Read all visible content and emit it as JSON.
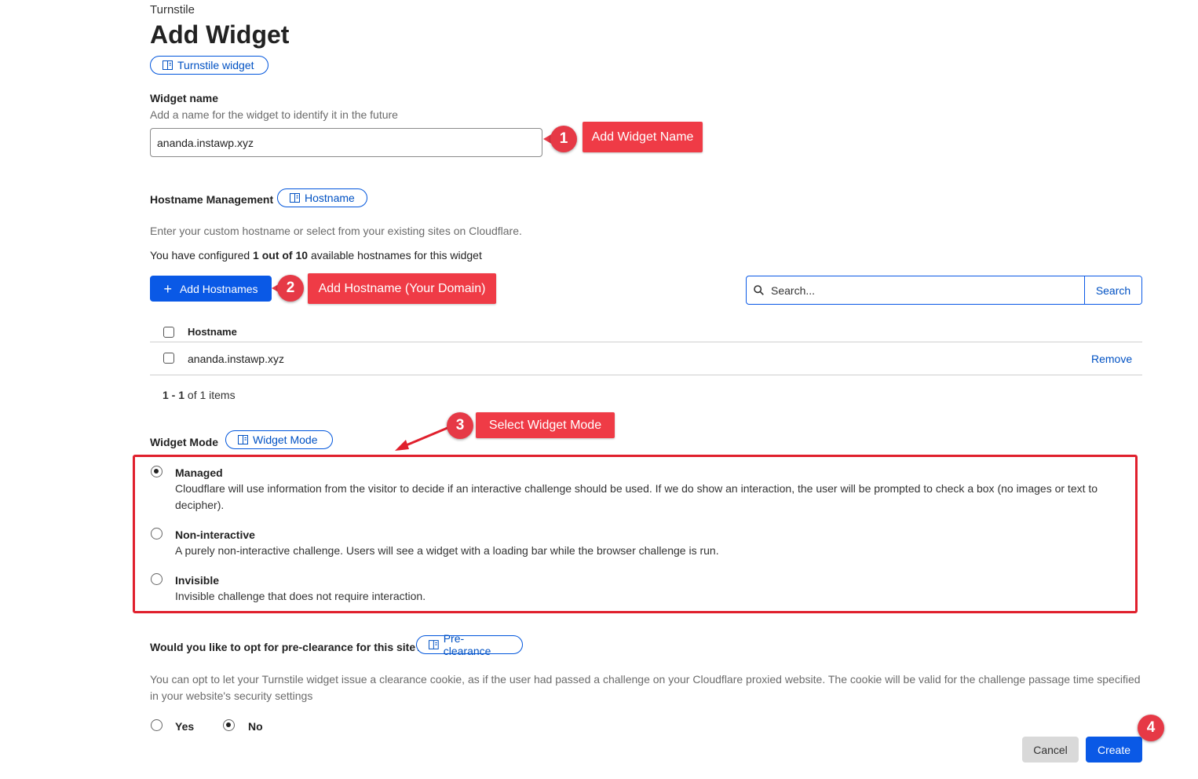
{
  "breadcrumb": "Turnstile",
  "title": "Add Widget",
  "doc_links": {
    "turnstile_widget": "Turnstile widget",
    "hostname": "Hostname",
    "widget_mode": "Widget Mode",
    "pre_clearance": "Pre-clearance"
  },
  "widget_name": {
    "label": "Widget name",
    "hint": "Add a name for the widget to identify it in the future",
    "value": "ananda.instawp.xyz"
  },
  "hostname_management": {
    "label": "Hostname Management",
    "hint": "Enter your custom hostname or select from your existing sites on Cloudflare.",
    "configured_prefix": "You have configured",
    "configured_count": "1 out of 10",
    "configured_suffix": "available hostnames for this widget",
    "add_button": "Add Hostnames",
    "search_placeholder": "Search...",
    "search_button": "Search",
    "table_header": "Hostname",
    "rows": [
      {
        "hostname": "ananda.instawp.xyz",
        "action": "Remove"
      }
    ],
    "pagination_range": "1 - 1",
    "pagination_suffix": "of 1 items"
  },
  "widget_mode": {
    "label": "Widget Mode",
    "options": [
      {
        "title": "Managed",
        "desc1": "Cloudflare will use information from the visitor to decide if an interactive challenge should be used. If we do show an interaction, the user will be prompted to check a box (no images or text to",
        "desc2": "decipher).",
        "selected": true
      },
      {
        "title": "Non-interactive",
        "desc1": "A purely non-interactive challenge. Users will see a widget with a loading bar while the browser challenge is run.",
        "selected": false
      },
      {
        "title": "Invisible",
        "desc1": "Invisible challenge that does not require interaction.",
        "selected": false
      }
    ]
  },
  "pre_clearance": {
    "question": "Would you like to opt for pre-clearance for this site?",
    "hint1": "You can opt to let your Turnstile widget issue a clearance cookie, as if the user had passed a challenge on your Cloudflare proxied website. The cookie will be valid for the challenge passage time specified",
    "hint2": "in your website's security settings",
    "yes": "Yes",
    "no": "No",
    "selected": "No"
  },
  "actions": {
    "cancel": "Cancel",
    "create": "Create"
  },
  "annotations": {
    "step1": {
      "number": "1",
      "label": "Add Widget Name"
    },
    "step2": {
      "number": "2",
      "label": "Add Hostname (Your Domain)"
    },
    "step3": {
      "number": "3",
      "label": "Select Widget Mode"
    },
    "step4": {
      "number": "4"
    }
  },
  "colors": {
    "primary": "#0a59e6",
    "link": "#0051c3",
    "annotation_red": "#ef3b46",
    "highlight_border": "#e0202d"
  }
}
